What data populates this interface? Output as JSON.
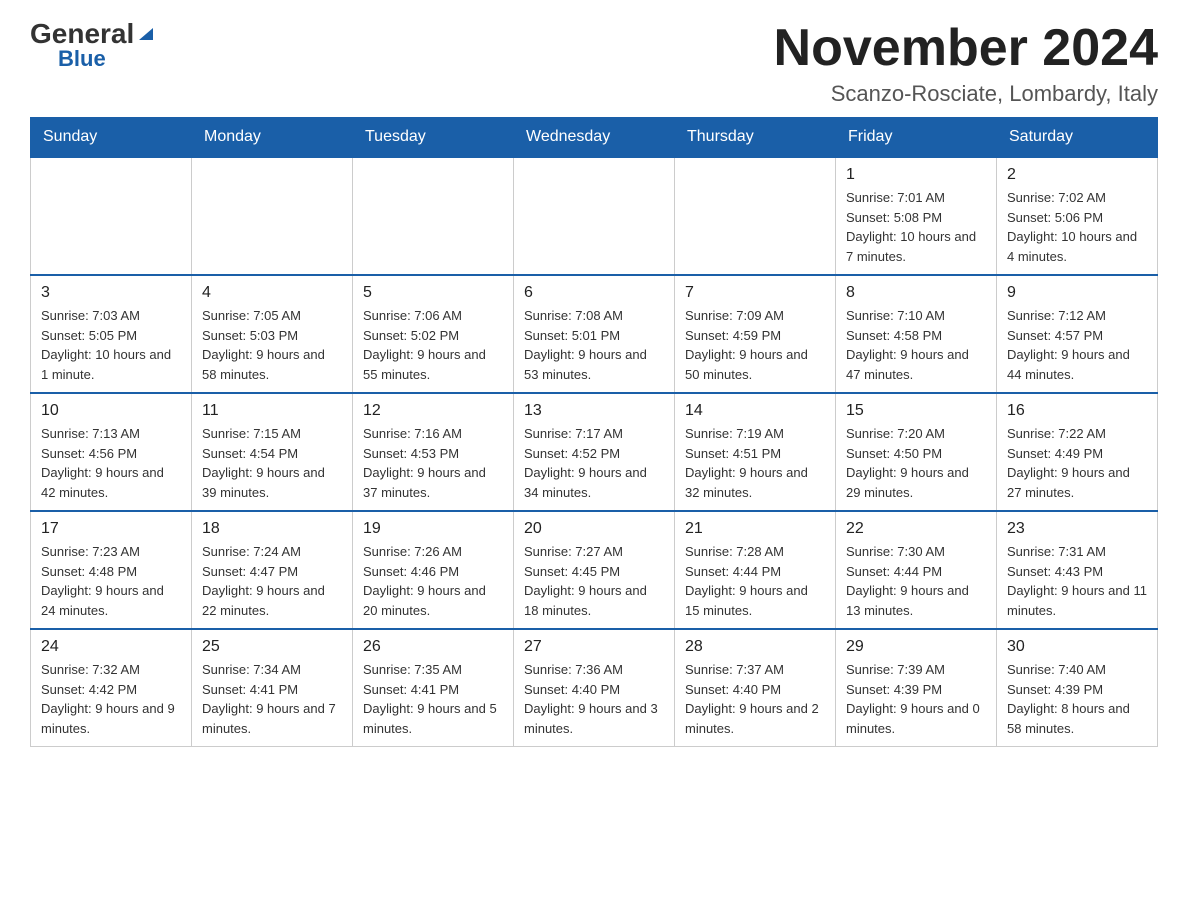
{
  "header": {
    "logo_general": "General",
    "logo_blue": "Blue",
    "month_title": "November 2024",
    "location": "Scanzo-Rosciate, Lombardy, Italy"
  },
  "days_of_week": [
    "Sunday",
    "Monday",
    "Tuesday",
    "Wednesday",
    "Thursday",
    "Friday",
    "Saturday"
  ],
  "weeks": [
    {
      "days": [
        {
          "number": "",
          "info": ""
        },
        {
          "number": "",
          "info": ""
        },
        {
          "number": "",
          "info": ""
        },
        {
          "number": "",
          "info": ""
        },
        {
          "number": "",
          "info": ""
        },
        {
          "number": "1",
          "info": "Sunrise: 7:01 AM\nSunset: 5:08 PM\nDaylight: 10 hours and 7 minutes."
        },
        {
          "number": "2",
          "info": "Sunrise: 7:02 AM\nSunset: 5:06 PM\nDaylight: 10 hours and 4 minutes."
        }
      ]
    },
    {
      "days": [
        {
          "number": "3",
          "info": "Sunrise: 7:03 AM\nSunset: 5:05 PM\nDaylight: 10 hours and 1 minute."
        },
        {
          "number": "4",
          "info": "Sunrise: 7:05 AM\nSunset: 5:03 PM\nDaylight: 9 hours and 58 minutes."
        },
        {
          "number": "5",
          "info": "Sunrise: 7:06 AM\nSunset: 5:02 PM\nDaylight: 9 hours and 55 minutes."
        },
        {
          "number": "6",
          "info": "Sunrise: 7:08 AM\nSunset: 5:01 PM\nDaylight: 9 hours and 53 minutes."
        },
        {
          "number": "7",
          "info": "Sunrise: 7:09 AM\nSunset: 4:59 PM\nDaylight: 9 hours and 50 minutes."
        },
        {
          "number": "8",
          "info": "Sunrise: 7:10 AM\nSunset: 4:58 PM\nDaylight: 9 hours and 47 minutes."
        },
        {
          "number": "9",
          "info": "Sunrise: 7:12 AM\nSunset: 4:57 PM\nDaylight: 9 hours and 44 minutes."
        }
      ]
    },
    {
      "days": [
        {
          "number": "10",
          "info": "Sunrise: 7:13 AM\nSunset: 4:56 PM\nDaylight: 9 hours and 42 minutes."
        },
        {
          "number": "11",
          "info": "Sunrise: 7:15 AM\nSunset: 4:54 PM\nDaylight: 9 hours and 39 minutes."
        },
        {
          "number": "12",
          "info": "Sunrise: 7:16 AM\nSunset: 4:53 PM\nDaylight: 9 hours and 37 minutes."
        },
        {
          "number": "13",
          "info": "Sunrise: 7:17 AM\nSunset: 4:52 PM\nDaylight: 9 hours and 34 minutes."
        },
        {
          "number": "14",
          "info": "Sunrise: 7:19 AM\nSunset: 4:51 PM\nDaylight: 9 hours and 32 minutes."
        },
        {
          "number": "15",
          "info": "Sunrise: 7:20 AM\nSunset: 4:50 PM\nDaylight: 9 hours and 29 minutes."
        },
        {
          "number": "16",
          "info": "Sunrise: 7:22 AM\nSunset: 4:49 PM\nDaylight: 9 hours and 27 minutes."
        }
      ]
    },
    {
      "days": [
        {
          "number": "17",
          "info": "Sunrise: 7:23 AM\nSunset: 4:48 PM\nDaylight: 9 hours and 24 minutes."
        },
        {
          "number": "18",
          "info": "Sunrise: 7:24 AM\nSunset: 4:47 PM\nDaylight: 9 hours and 22 minutes."
        },
        {
          "number": "19",
          "info": "Sunrise: 7:26 AM\nSunset: 4:46 PM\nDaylight: 9 hours and 20 minutes."
        },
        {
          "number": "20",
          "info": "Sunrise: 7:27 AM\nSunset: 4:45 PM\nDaylight: 9 hours and 18 minutes."
        },
        {
          "number": "21",
          "info": "Sunrise: 7:28 AM\nSunset: 4:44 PM\nDaylight: 9 hours and 15 minutes."
        },
        {
          "number": "22",
          "info": "Sunrise: 7:30 AM\nSunset: 4:44 PM\nDaylight: 9 hours and 13 minutes."
        },
        {
          "number": "23",
          "info": "Sunrise: 7:31 AM\nSunset: 4:43 PM\nDaylight: 9 hours and 11 minutes."
        }
      ]
    },
    {
      "days": [
        {
          "number": "24",
          "info": "Sunrise: 7:32 AM\nSunset: 4:42 PM\nDaylight: 9 hours and 9 minutes."
        },
        {
          "number": "25",
          "info": "Sunrise: 7:34 AM\nSunset: 4:41 PM\nDaylight: 9 hours and 7 minutes."
        },
        {
          "number": "26",
          "info": "Sunrise: 7:35 AM\nSunset: 4:41 PM\nDaylight: 9 hours and 5 minutes."
        },
        {
          "number": "27",
          "info": "Sunrise: 7:36 AM\nSunset: 4:40 PM\nDaylight: 9 hours and 3 minutes."
        },
        {
          "number": "28",
          "info": "Sunrise: 7:37 AM\nSunset: 4:40 PM\nDaylight: 9 hours and 2 minutes."
        },
        {
          "number": "29",
          "info": "Sunrise: 7:39 AM\nSunset: 4:39 PM\nDaylight: 9 hours and 0 minutes."
        },
        {
          "number": "30",
          "info": "Sunrise: 7:40 AM\nSunset: 4:39 PM\nDaylight: 8 hours and 58 minutes."
        }
      ]
    }
  ]
}
